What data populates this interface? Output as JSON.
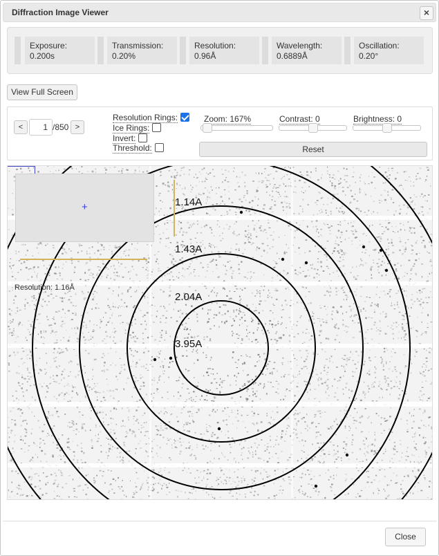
{
  "dialog": {
    "title": "Diffraction Image Viewer",
    "close_icon": "×"
  },
  "info": [
    {
      "label": "Exposure:",
      "value": "0.200s"
    },
    {
      "label": "Transmission:",
      "value": "0.20%"
    },
    {
      "label": "Resolution:",
      "value": "0.96Å"
    },
    {
      "label": "Wavelength:",
      "value": "0.6889Å"
    },
    {
      "label": "Oscillation:",
      "value": "0.20°"
    }
  ],
  "toolbar": {
    "full_screen_label": "View Full Screen"
  },
  "controls": {
    "prev_label": "<",
    "next_label": ">",
    "frame_value": "1",
    "frame_total": "/850",
    "options": [
      {
        "label": "Resolution Rings:",
        "checked": true
      },
      {
        "label": "Ice Rings:",
        "checked": false
      },
      {
        "label": "Invert:",
        "checked": false
      },
      {
        "label": "Threshold:",
        "checked": false
      }
    ],
    "zoom": {
      "label": "Zoom: 167%",
      "level": 0.02
    },
    "contrast": {
      "label": "Contrast: 0",
      "level": 0.5
    },
    "brightness": {
      "label": "Brightness: 0",
      "level": 0.5
    },
    "reset_label": "Reset"
  },
  "viewer": {
    "resolution_readout": "Resolution: 1.16Å",
    "crosshair": "+",
    "ring_labels": [
      "1.14A",
      "1.43A",
      "2.04A",
      "3.95A"
    ],
    "ring_color": "#000000",
    "measure_color": "#d4b45a",
    "crosshair_color": "#3a3ae0"
  },
  "footer": {
    "close_label": "Close"
  }
}
